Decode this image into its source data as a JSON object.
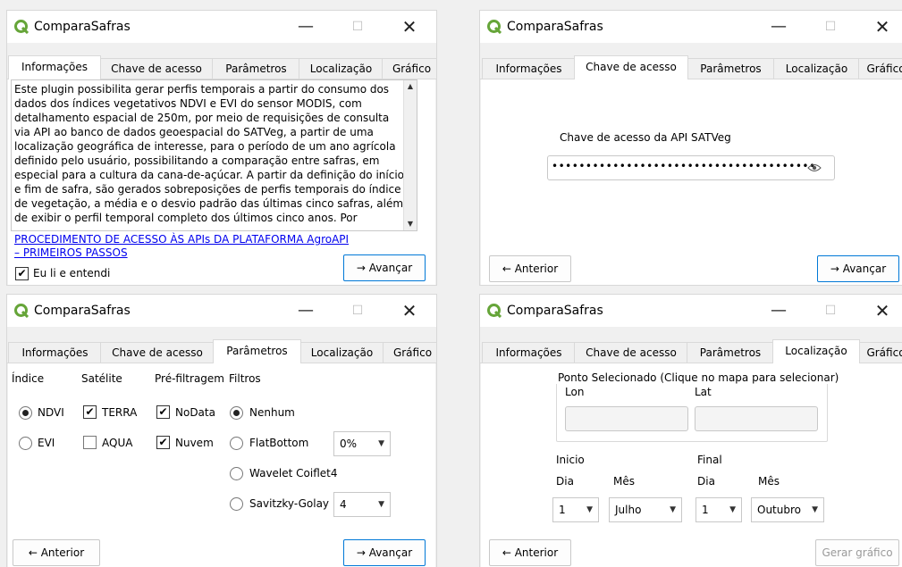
{
  "app": {
    "title": "ComparaSafras",
    "accent_color": "#0078d7",
    "icon_color": "#66a539",
    "controls": {
      "minimize": "—",
      "maximize": "☐",
      "close": "✕"
    }
  },
  "tabs": [
    "Informações",
    "Chave de acesso",
    "Parâmetros",
    "Localização",
    "Gráfico"
  ],
  "info": {
    "text": "Este plugin possibilita gerar perfis temporais a partir do consumo dos dados dos índices vegetativos NDVI e EVI do sensor MODIS, com detalhamento espacial de 250m, por meio de requisições de consulta via API ao banco de dados geoespacial do SATVeg, a partir de uma localização geográfica de interesse, para o período de um ano agrícola definido pelo usuário, possibilitando a comparação entre safras, em especial para a cultura da cana-de-açúcar. A partir da definição do início e fim de safra, são gerados sobreposições de perfis temporais do índice de vegetação, a média e o desvio padrão das últimas cinco safras, além de exibir o perfil temporal completo dos últimos cinco anos. Por",
    "link_line1": "PROCEDIMENTO DE ACESSO ÀS APIs DA PLATAFORMA AgroAPI",
    "link_line2": "– PRIMEIROS PASSOS",
    "checkbox_label": "Eu li e entendi",
    "next_label": "→ Avançar"
  },
  "key": {
    "label": "Chave de acesso da API SATVeg",
    "value": "•••••••••••••••••••••••••••••••••••••••",
    "prev_label": "← Anterior",
    "next_label": "→ Avançar"
  },
  "params": {
    "headers": {
      "indice": "Índice",
      "satelite": "Satélite",
      "prefiltro": "Pré-filtragem",
      "filtros": "Filtros"
    },
    "indice": [
      {
        "label": "NDVI",
        "selected": true
      },
      {
        "label": "EVI",
        "selected": false
      }
    ],
    "satelite": [
      {
        "label": "TERRA",
        "checked": true
      },
      {
        "label": "AQUA",
        "checked": false
      }
    ],
    "prefiltro": [
      {
        "label": "NoData",
        "checked": true
      },
      {
        "label": "Nuvem",
        "checked": true
      }
    ],
    "filtros": [
      {
        "label": "Nenhum",
        "selected": true
      },
      {
        "label": "FlatBottom",
        "selected": false
      },
      {
        "label": "Wavelet Coiflet4",
        "selected": false
      },
      {
        "label": "Savitzky-Golay",
        "selected": false
      }
    ],
    "flatbottom_value": "0%",
    "savitzky_value": "4",
    "prev_label": "← Anterior",
    "next_label": "→ Avançar"
  },
  "location": {
    "group_title": "Ponto Selecionado (Clique no mapa para selecionar)",
    "lon_label": "Lon",
    "lat_label": "Lat",
    "inicio_label": "Inicio",
    "final_label": "Final",
    "dia_label": "Dia",
    "mes_label": "Mês",
    "inicio_dia": "1",
    "inicio_mes": "Julho",
    "final_dia": "1",
    "final_mes": "Outubro",
    "prev_label": "← Anterior",
    "generate_label": "Gerar gráfico"
  }
}
